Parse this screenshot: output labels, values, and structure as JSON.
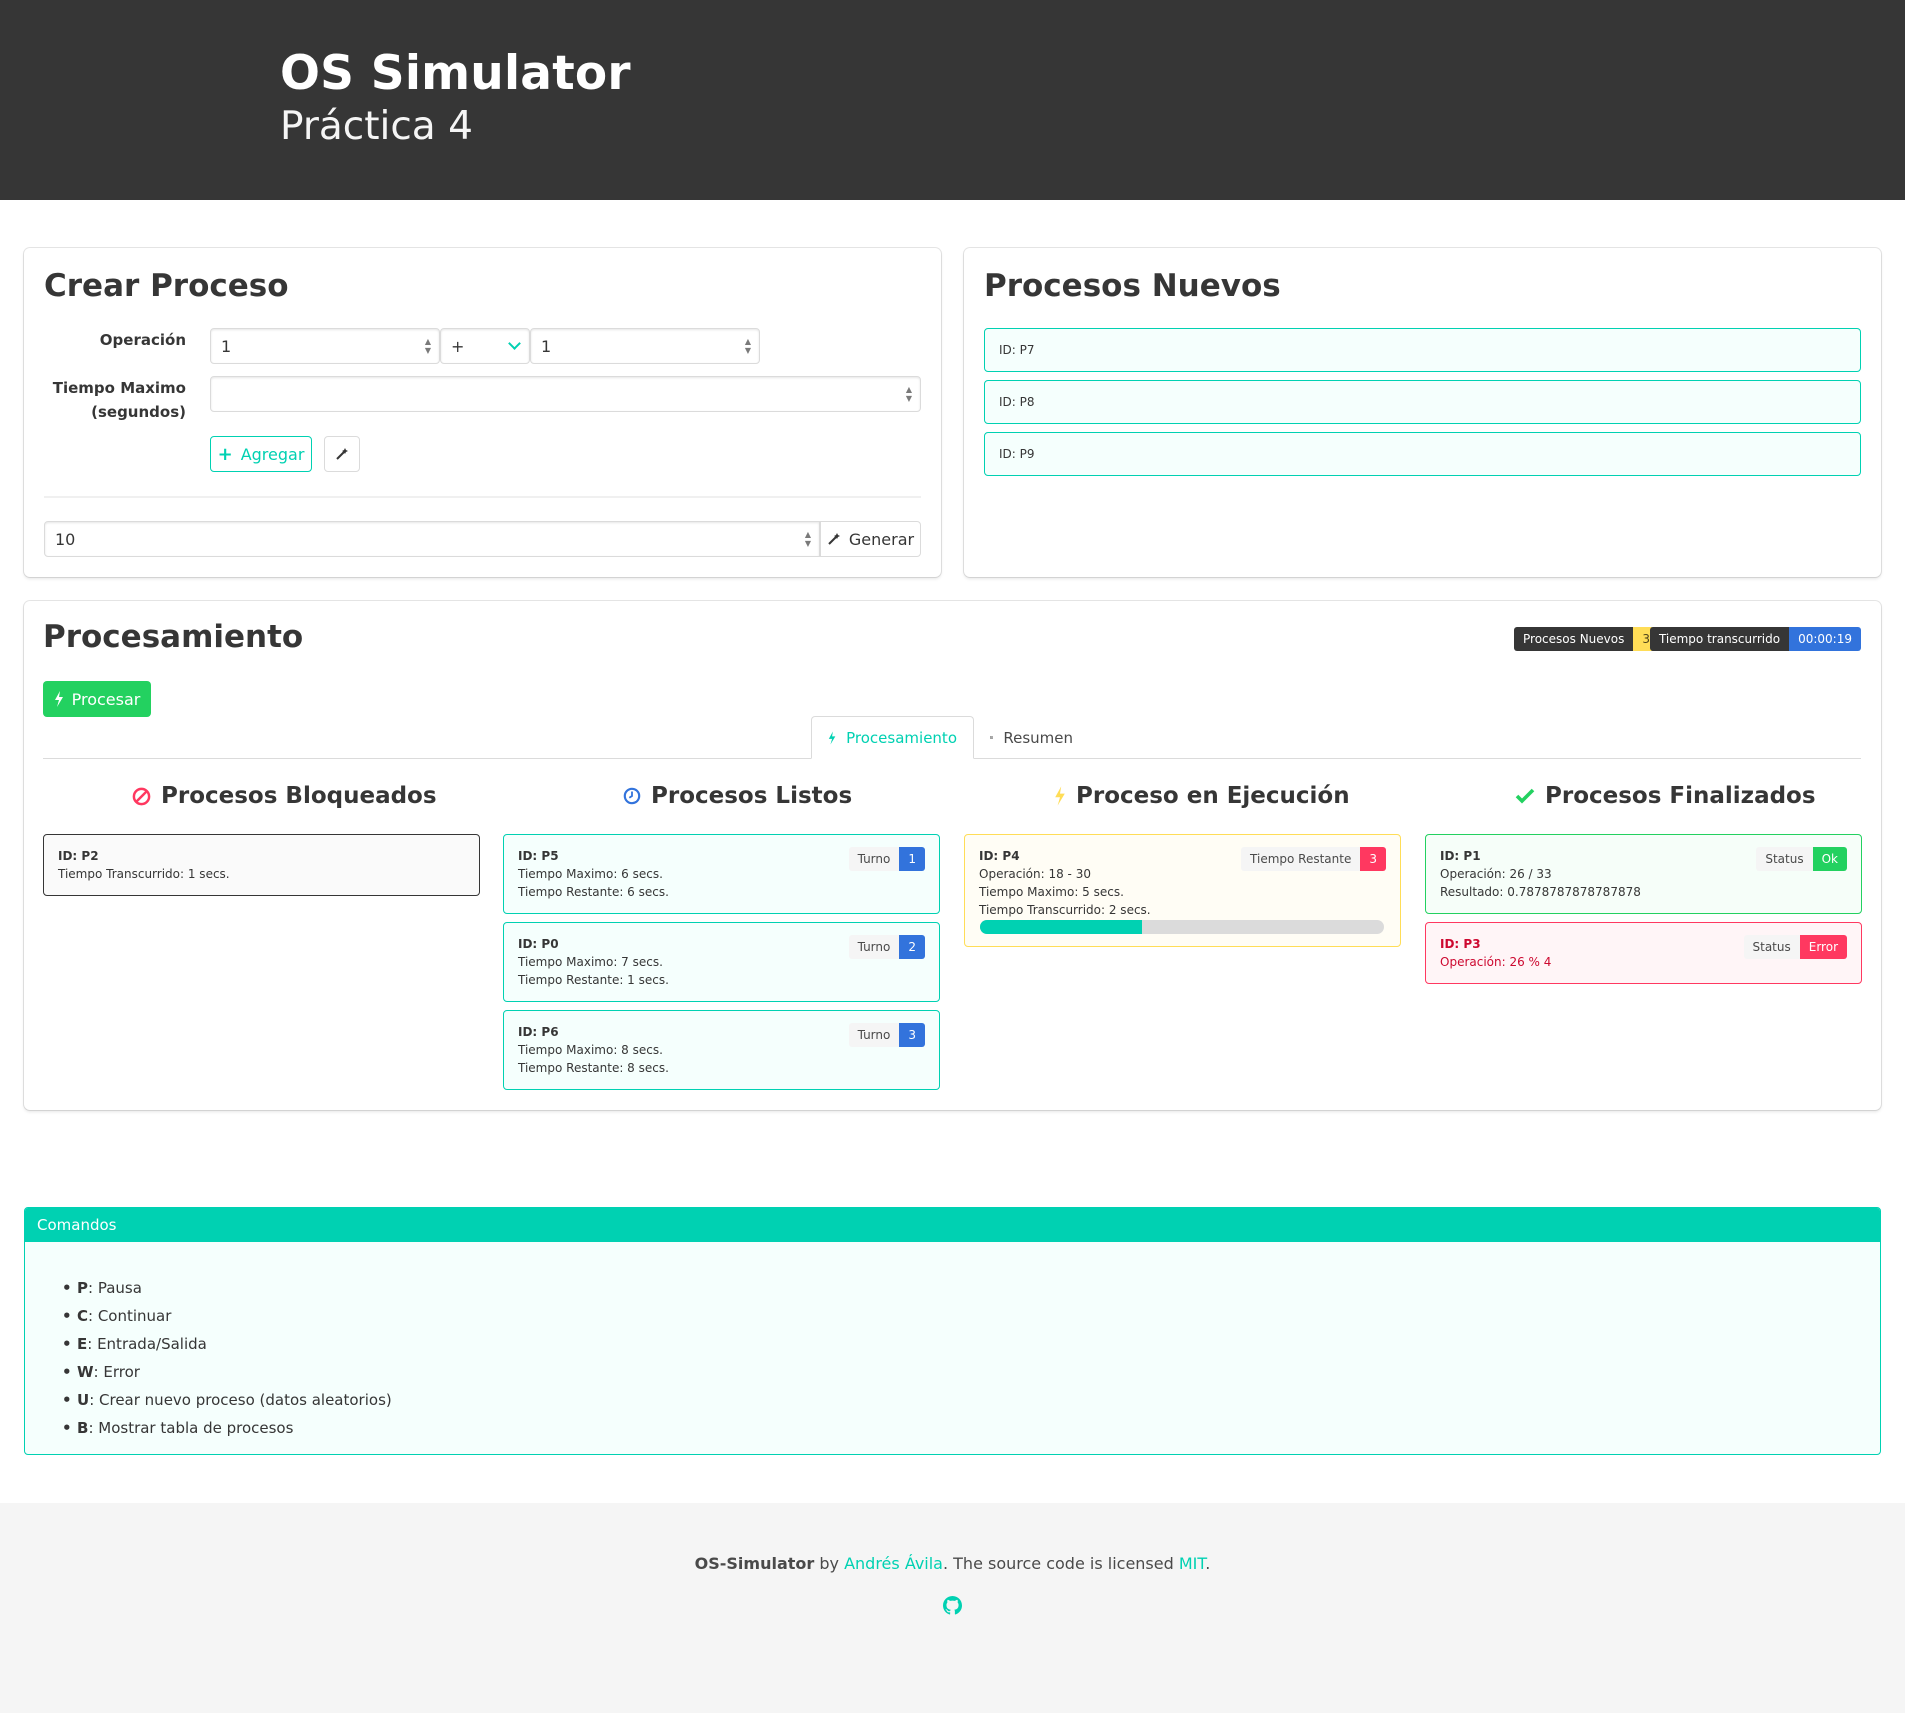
{
  "hero": {
    "title": "OS Simulator",
    "subtitle": "Práctica 4"
  },
  "crear": {
    "title": "Crear Proceso",
    "operacion_label": "Operación",
    "operand_a": "1",
    "operator": "+",
    "operand_b": "1",
    "tiempo_label_1": "Tiempo Maximo",
    "tiempo_label_2": "(segundos)",
    "tiempo_value": "",
    "agregar_label": "Agregar",
    "generar_count": "10",
    "generar_label": "Generar"
  },
  "nuevos": {
    "title": "Procesos Nuevos",
    "items": [
      {
        "id": "ID: P7"
      },
      {
        "id": "ID: P8"
      },
      {
        "id": "ID: P9"
      }
    ]
  },
  "procesamiento": {
    "title": "Procesamiento",
    "procesar_label": "Procesar",
    "tag_nuevos_label": "Procesos Nuevos",
    "tag_nuevos_value": "3",
    "tag_tiempo_label": "Tiempo transcurrido",
    "tag_tiempo_value": "00:00:19",
    "tabs": [
      {
        "label": "Procesamiento"
      },
      {
        "label": "Resumen"
      }
    ],
    "bloqueados": {
      "title": "Procesos Bloqueados",
      "items": [
        {
          "id": "ID: P2",
          "line1": "Tiempo Transcurrido: 1 secs."
        }
      ]
    },
    "listos": {
      "title": "Procesos Listos",
      "items": [
        {
          "id": "ID: P5",
          "line1": "Tiempo Maximo: 6 secs.",
          "line2": "Tiempo Restante: 6 secs.",
          "turno_label": "Turno",
          "turno": "1"
        },
        {
          "id": "ID: P0",
          "line1": "Tiempo Maximo: 7 secs.",
          "line2": "Tiempo Restante: 1 secs.",
          "turno_label": "Turno",
          "turno": "2"
        },
        {
          "id": "ID: P6",
          "line1": "Tiempo Maximo: 8 secs.",
          "line2": "Tiempo Restante: 8 secs.",
          "turno_label": "Turno",
          "turno": "3"
        }
      ]
    },
    "ejecucion": {
      "title": "Proceso en Ejecución",
      "id": "ID: P4",
      "line1": "Operación: 18 - 30",
      "line2": "Tiempo Maximo: 5 secs.",
      "line3": "Tiempo Transcurrido: 2 secs.",
      "restante_label": "Tiempo Restante",
      "restante": "3",
      "progress_fraction": 0.4
    },
    "finalizados": {
      "title": "Procesos Finalizados",
      "items": [
        {
          "id": "ID: P1",
          "line1": "Operación: 26 / 33",
          "line2": "Resultado: 0.7878787878787878",
          "status_label": "Status",
          "status": "Ok"
        },
        {
          "id": "ID: P3",
          "line1": "Operación: 26 % 4",
          "status_label": "Status",
          "status": "Error"
        }
      ]
    }
  },
  "comandos": {
    "header": "Comandos",
    "items": [
      {
        "key": "P",
        "text": ": Pausa"
      },
      {
        "key": "C",
        "text": ": Continuar"
      },
      {
        "key": "E",
        "text": ": Entrada/Salida"
      },
      {
        "key": "W",
        "text": ": Error"
      },
      {
        "key": "U",
        "text": ": Crear nuevo proceso (datos aleatorios)"
      },
      {
        "key": "B",
        "text": ": Mostrar tabla de procesos"
      }
    ]
  },
  "footer": {
    "project": "OS-Simulator",
    "by": " by ",
    "author": "Andrés Ávila",
    "license_text": ". The source code is licensed ",
    "license": "MIT",
    "end": "."
  },
  "colors": {
    "primary": "#00d1b2",
    "dark": "#363636",
    "warning": "#ffdd57",
    "success": "#23d160",
    "danger": "#ff3860",
    "info": "#3273dc"
  },
  "icons": [
    "plus-icon",
    "magic-wand-icon",
    "bolt-icon",
    "table-icon",
    "ban-icon",
    "clock-icon",
    "check-icon",
    "github-icon"
  ]
}
